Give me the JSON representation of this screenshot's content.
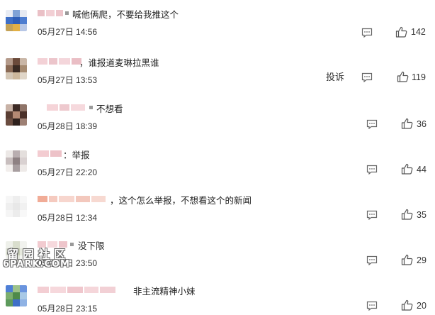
{
  "comments": [
    {
      "text": "喊他俩爬，不要给我推这个",
      "time": "05月27日 14:56",
      "likes": "142",
      "report": ""
    },
    {
      "text": "，谁报道麦琳拉黑谁",
      "time": "05月27日 13:53",
      "likes": "119",
      "report": "投诉"
    },
    {
      "text": "不想看",
      "time": "05月28日 18:39",
      "likes": "36",
      "report": ""
    },
    {
      "text": "：举报",
      "time": "05月27日 22:20",
      "likes": "44",
      "report": ""
    },
    {
      "text": "，这个怎么举报，不想看这个的新闻",
      "time": "05月28日 12:34",
      "likes": "35",
      "report": ""
    },
    {
      "text": "没下限",
      "time": "05月28日 23:50",
      "likes": "29",
      "report": ""
    },
    {
      "text": "非主流精神小妹",
      "time": "05月28日 23:15",
      "likes": "20",
      "report": ""
    }
  ],
  "watermark": {
    "cn": "留园社区",
    "en": "6PARK.COM"
  },
  "icons": {
    "reply": "comment-reply-icon",
    "like": "thumbs-up-icon"
  }
}
